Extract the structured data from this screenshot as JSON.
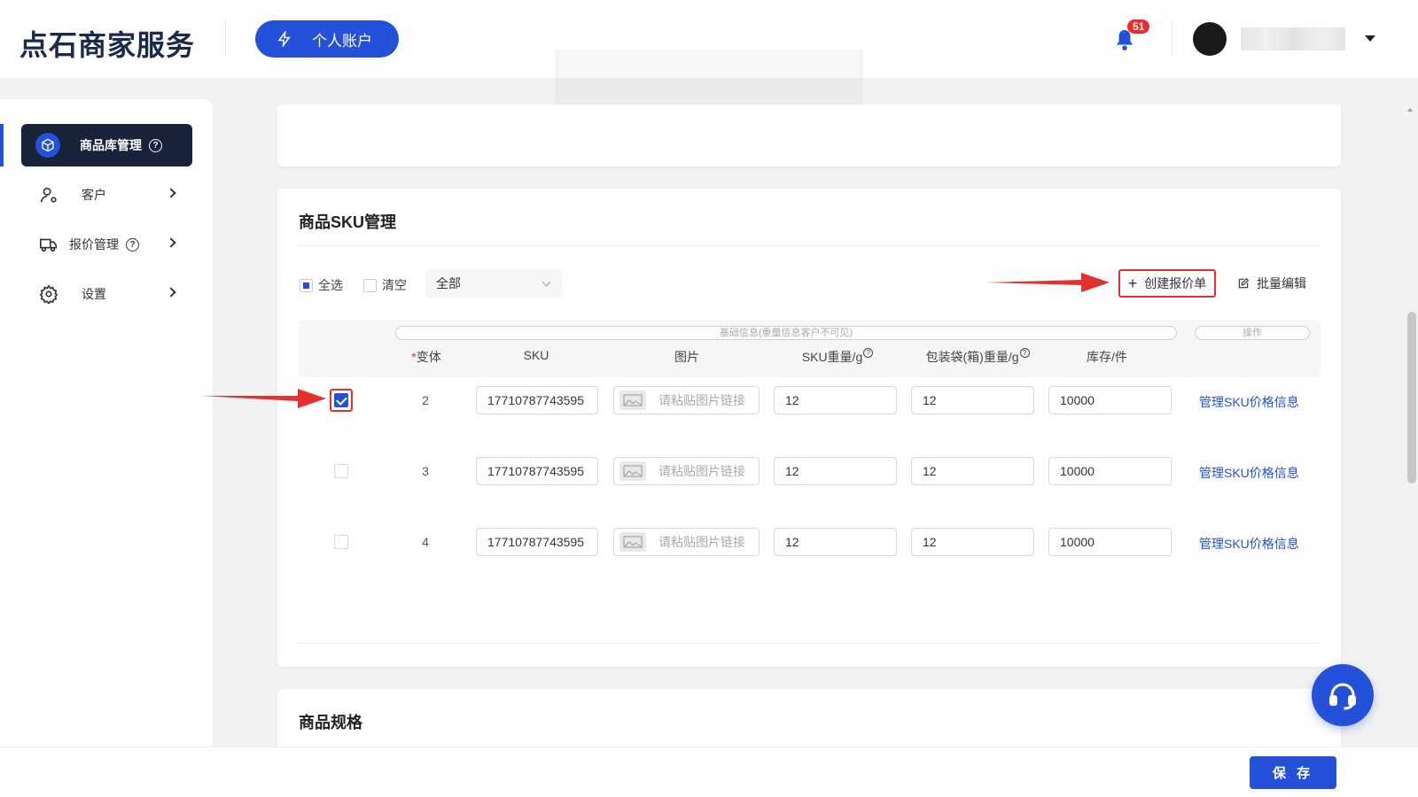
{
  "header": {
    "logo": "点石商家服务",
    "account_button": "个人账户",
    "notification_count": "51",
    "username": ""
  },
  "sidebar": {
    "items": [
      {
        "label": "商品库管理",
        "icon": "box-icon",
        "active": true,
        "help": "?"
      },
      {
        "label": "客户",
        "icon": "user-icon"
      },
      {
        "label": "报价管理",
        "icon": "truck-icon",
        "help": "?"
      },
      {
        "label": "设置",
        "icon": "gear-icon"
      }
    ]
  },
  "sku_section": {
    "title": "商品SKU管理",
    "select_all": "全选",
    "clear": "清空",
    "filter_value": "全部",
    "create_quote": "创建报价单",
    "batch_edit": "批量编辑",
    "group_basic": "基础信息(重量信息客户不可见)",
    "group_ops": "操作",
    "columns": {
      "variant_req": "*",
      "variant": "变体",
      "sku": "SKU",
      "image": "图片",
      "sku_weight": "SKU重量/g",
      "package_weight": "包装袋(箱)重量/g",
      "stock": "库存/件"
    },
    "rows": [
      {
        "checked": true,
        "variant": "2",
        "sku": "17710787743595",
        "image_placeholder": "请粘贴图片链接",
        "sku_weight": "12",
        "package_weight": "12",
        "stock": "10000",
        "action": "管理SKU价格信息"
      },
      {
        "checked": false,
        "variant": "3",
        "sku": "17710787743595",
        "image_placeholder": "请粘贴图片链接",
        "sku_weight": "12",
        "package_weight": "12",
        "stock": "10000",
        "action": "管理SKU价格信息"
      },
      {
        "checked": false,
        "variant": "4",
        "sku": "17710787743595",
        "image_placeholder": "请粘贴图片链接",
        "sku_weight": "12",
        "package_weight": "12",
        "stock": "10000",
        "action": "管理SKU价格信息"
      }
    ]
  },
  "spec_section": {
    "title": "商品规格"
  },
  "footer": {
    "save": "保 存"
  },
  "colors": {
    "primary": "#2451d9",
    "sidebar_active": "#182238",
    "annotation": "#e53030"
  }
}
